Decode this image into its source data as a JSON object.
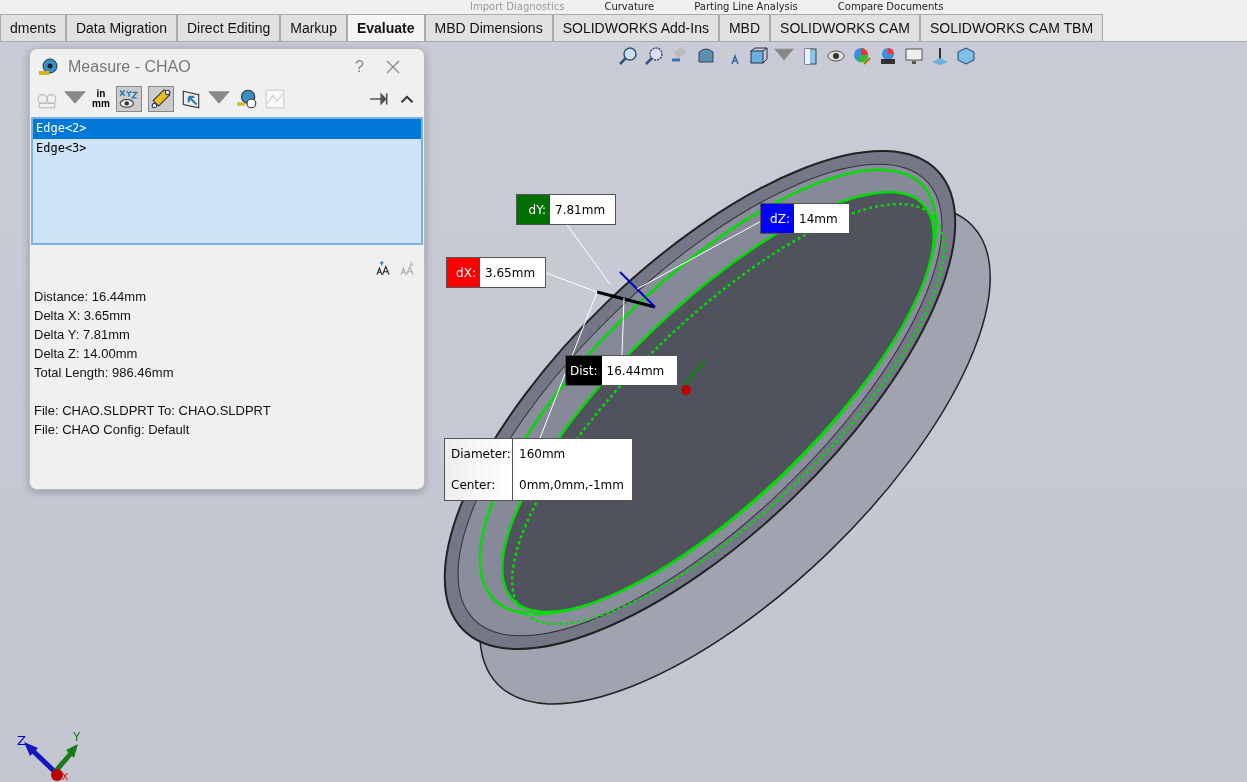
{
  "ribbon_top": [
    "Import Diagnostics",
    "Curvature",
    "Parting Line Analysis",
    "Compare Documents"
  ],
  "tabs": [
    {
      "label": "dments",
      "selected": false
    },
    {
      "label": "Data Migration",
      "selected": false
    },
    {
      "label": "Direct Editing",
      "selected": false
    },
    {
      "label": "Markup",
      "selected": false
    },
    {
      "label": "Evaluate",
      "selected": true
    },
    {
      "label": "MBD Dimensions",
      "selected": false
    },
    {
      "label": "SOLIDWORKS Add-Ins",
      "selected": false
    },
    {
      "label": "MBD",
      "selected": false
    },
    {
      "label": "SOLIDWORKS CAM",
      "selected": false
    },
    {
      "label": "SOLIDWORKS CAM TBM",
      "selected": false
    }
  ],
  "dialog": {
    "title": "Measure - CHAO",
    "help": "?",
    "units_top": "in",
    "units_bottom": "mm",
    "selections": [
      {
        "label": "Edge<2>",
        "selected": true
      },
      {
        "label": "Edge<3>",
        "selected": false
      }
    ],
    "results": [
      "Distance: 16.44mm",
      "Delta X: 3.65mm",
      "Delta Y: 7.81mm",
      "Delta Z: 14.00mm",
      "Total Length: 986.46mm"
    ],
    "files": [
      "File: CHAO.SLDPRT To: CHAO.SLDPRT",
      "File: CHAO Config: Default"
    ]
  },
  "callouts": [
    {
      "label": "dY:",
      "value": "7.81mm",
      "color": "#007000"
    },
    {
      "label": "dZ:",
      "value": "14mm",
      "color": "#0000ff"
    },
    {
      "label": "dX:",
      "value": "3.65mm",
      "color": "#ff0000"
    },
    {
      "label": "Dist:",
      "value": "16.44mm",
      "color": "#000000"
    }
  ],
  "circle_info": {
    "rows": [
      {
        "label": "Diameter:",
        "value": "160mm"
      },
      {
        "label": "Center:",
        "value": "0mm,0mm,-1mm"
      }
    ]
  },
  "triad": {
    "x": "X",
    "y": "Y",
    "z": "Z"
  }
}
